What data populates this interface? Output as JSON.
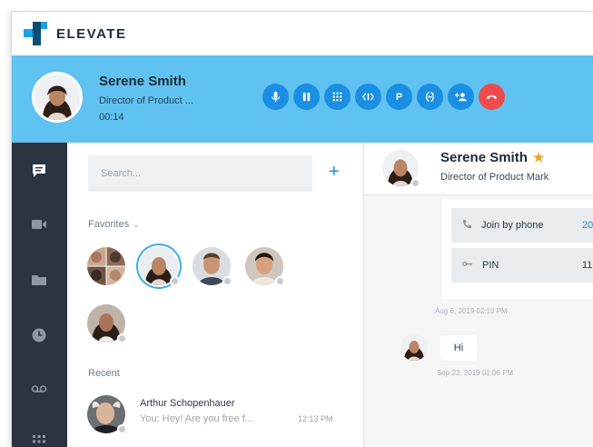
{
  "brand": {
    "name": "ELEVATE"
  },
  "call": {
    "name": "Serene Smith",
    "title": "Director of Product ...",
    "duration": "00:14",
    "buttons": [
      {
        "name": "mute-button",
        "icon": "microphone-icon",
        "label": ""
      },
      {
        "name": "hold-button",
        "icon": "pause-icon",
        "label": ""
      },
      {
        "name": "keypad-button",
        "icon": "dialpad-icon",
        "label": ""
      },
      {
        "name": "transfer-button",
        "icon": "transfer-icon",
        "label": ""
      },
      {
        "name": "park-button",
        "icon": "park-icon",
        "label": "P"
      },
      {
        "name": "merge-button",
        "icon": "merge-icon",
        "label": ""
      },
      {
        "name": "add-call-button",
        "icon": "add-participant-icon",
        "label": ""
      },
      {
        "name": "end-call-button",
        "icon": "hangup-icon",
        "label": ""
      }
    ],
    "colors": {
      "bar": "#60c2f0",
      "button": "#1a8fe3",
      "end": "#f04b4b"
    }
  },
  "rail": {
    "items": [
      {
        "name": "nav-messages",
        "icon": "chat-icon"
      },
      {
        "name": "nav-meetings",
        "icon": "video-icon"
      },
      {
        "name": "nav-files",
        "icon": "folder-icon"
      },
      {
        "name": "nav-history",
        "icon": "clock-icon"
      },
      {
        "name": "nav-voicemail",
        "icon": "voicemail-icon"
      },
      {
        "name": "nav-apps",
        "icon": "grid-icon"
      }
    ]
  },
  "contacts": {
    "search_placeholder": "Search...",
    "add_label": "+",
    "favorites_label": "Favorites",
    "favorites_caret": "⌄",
    "recent_label": "Recent",
    "recent": [
      {
        "name": "Arthur Schopenhauer",
        "message": "You: Hey! Are you free f...",
        "time": "12:13 PM"
      }
    ]
  },
  "chat": {
    "name": "Serene Smith",
    "star": "★",
    "title": "Director of Product Mark",
    "card": {
      "join_label": "Join by phone",
      "join_value": "20",
      "pin_label": "PIN",
      "pin_value": "11"
    },
    "ts1": "Aug 6, 2019 02:10 PM",
    "message": "Hi",
    "ts2": "Sep 23, 2019 01:06 PM"
  }
}
